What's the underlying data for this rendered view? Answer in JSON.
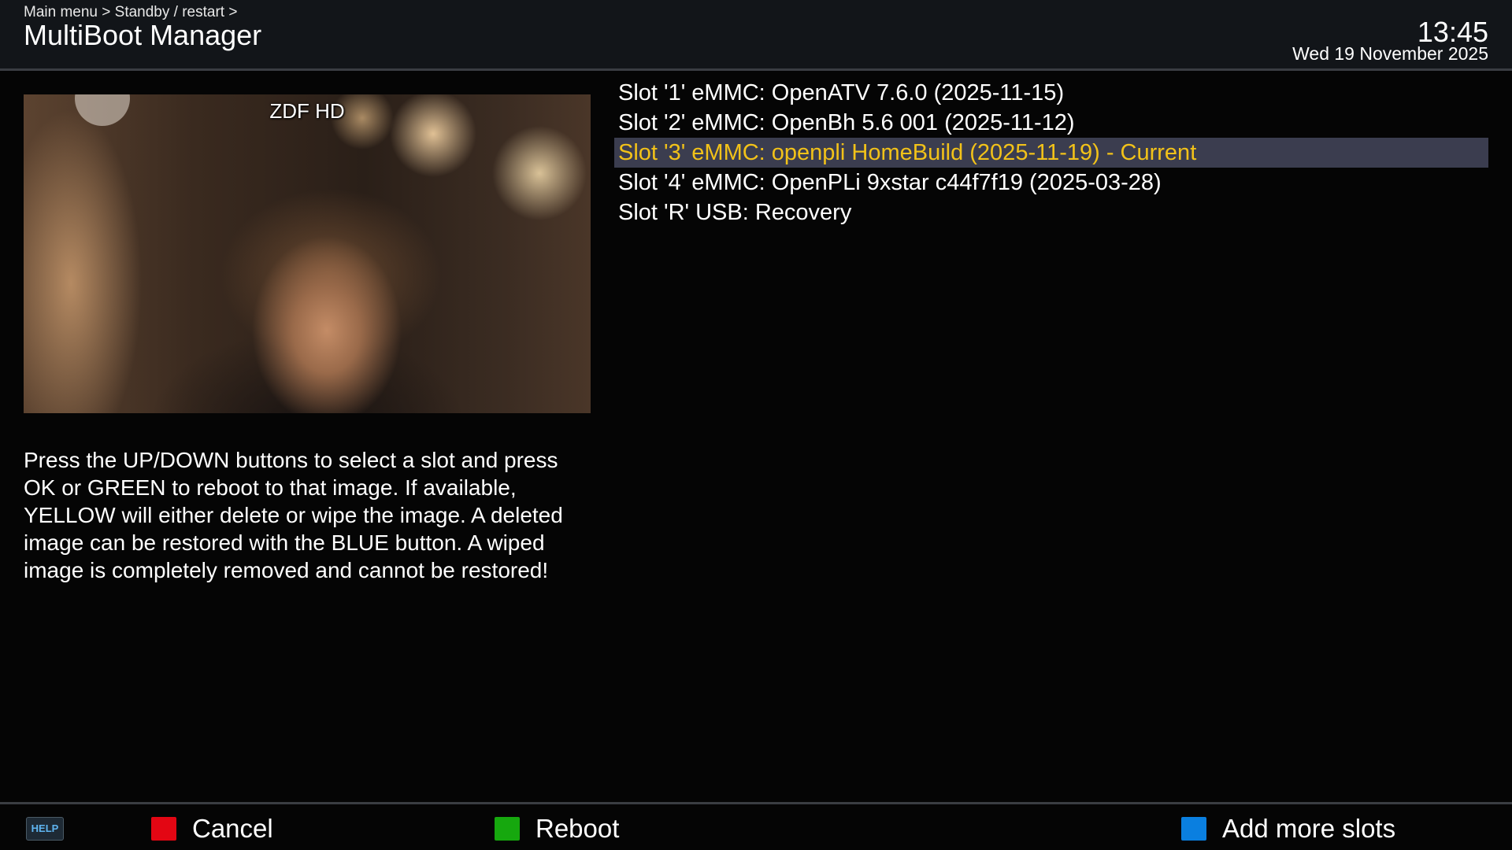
{
  "header": {
    "breadcrumb": "Main menu > Standby / restart >",
    "title": "MultiBoot Manager",
    "time": "13:45",
    "date": "Wed 19 November 2025"
  },
  "preview": {
    "channel_name": "ZDF HD"
  },
  "help_text": "Press the UP/DOWN buttons to select a slot and press OK or GREEN to reboot to that image. If available, YELLOW will either delete or wipe the image. A deleted image can be restored with the BLUE button. A wiped image is completely removed and cannot be restored!",
  "slots": [
    {
      "label": "Slot '1' eMMC: OpenATV 7.6.0 (2025-11-15)",
      "selected": false
    },
    {
      "label": "Slot '2' eMMC: OpenBh 5.6 001 (2025-11-12)",
      "selected": false
    },
    {
      "label": "Slot '3' eMMC: openpli HomeBuild (2025-11-19)  -  Current",
      "selected": true
    },
    {
      "label": "Slot '4' eMMC: OpenPLi 9xstar c44f7f19 (2025-03-28)",
      "selected": false
    },
    {
      "label": "Slot 'R' USB: Recovery",
      "selected": false
    }
  ],
  "footer": {
    "help_label": "HELP",
    "red_label": "Cancel",
    "green_label": "Reboot",
    "blue_label": "Add more slots"
  },
  "colors": {
    "red_key": "#e30613",
    "green_key": "#16a80e",
    "blue_key": "#0a7fe0",
    "selection_bg": "#3b3d4f",
    "selection_text": "#f2c219"
  }
}
